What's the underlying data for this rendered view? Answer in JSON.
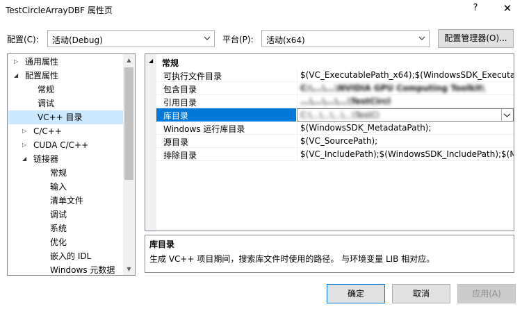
{
  "window": {
    "title": "TestCircleArrayDBF 属性页",
    "help_label": "?",
    "close_label": "✕"
  },
  "config": {
    "config_label": "配置(C):",
    "config_value": "活动(Debug)",
    "platform_label": "平台(P):",
    "platform_value": "活动(x64)",
    "manager_button": "配置管理器(O)..."
  },
  "tree": {
    "items": [
      {
        "label": "通用属性",
        "twisty": "▷"
      },
      {
        "label": "配置属性",
        "twisty": "◢"
      },
      {
        "label": "常规",
        "twisty": ""
      },
      {
        "label": "调试",
        "twisty": ""
      },
      {
        "label": "VC++ 目录",
        "twisty": ""
      },
      {
        "label": "C/C++",
        "twisty": "▷"
      },
      {
        "label": "CUDA C/C++",
        "twisty": "▷"
      },
      {
        "label": "链接器",
        "twisty": "◢"
      },
      {
        "label": "常规",
        "twisty": ""
      },
      {
        "label": "输入",
        "twisty": ""
      },
      {
        "label": "清单文件",
        "twisty": ""
      },
      {
        "label": "调试",
        "twisty": ""
      },
      {
        "label": "系统",
        "twisty": ""
      },
      {
        "label": "优化",
        "twisty": ""
      },
      {
        "label": "嵌入的 IDL",
        "twisty": ""
      },
      {
        "label": "Windows 元数据",
        "twisty": ""
      }
    ],
    "selected_index": 4
  },
  "grid": {
    "category": "常规",
    "category_twisty": "◢",
    "rows": [
      {
        "name": "可执行文件目录",
        "value": "$(VC_ExecutablePath_x64);$(WindowsSDK_ExecutablePa"
      },
      {
        "name": "包含目录",
        "value": "C:\\...\\...\\NVIDIA GPU Computing Toolkit\\",
        "redacted": true
      },
      {
        "name": "引用目录",
        "value": "...\\...\\...\\...\\TestCircl",
        "redacted": true
      },
      {
        "name": "库目录",
        "value": "C:\\...\\...\\...\\...\\TestCi",
        "redacted": true
      },
      {
        "name": "Windows 运行库目录",
        "value": "$(WindowsSDK_MetadataPath);"
      },
      {
        "name": "源目录",
        "value": "$(VC_SourcePath);"
      },
      {
        "name": "排除目录",
        "value": "$(VC_IncludePath);$(WindowsSDK_IncludePath);$(MSB"
      }
    ],
    "selected_index": 3
  },
  "description": {
    "title": "库目录",
    "text": "生成 VC++ 项目期间，搜索库文件时使用的路径。 与环境变量 LIB 相对应。"
  },
  "buttons": {
    "ok": "确定",
    "cancel": "取消",
    "apply": "应用(A)"
  }
}
